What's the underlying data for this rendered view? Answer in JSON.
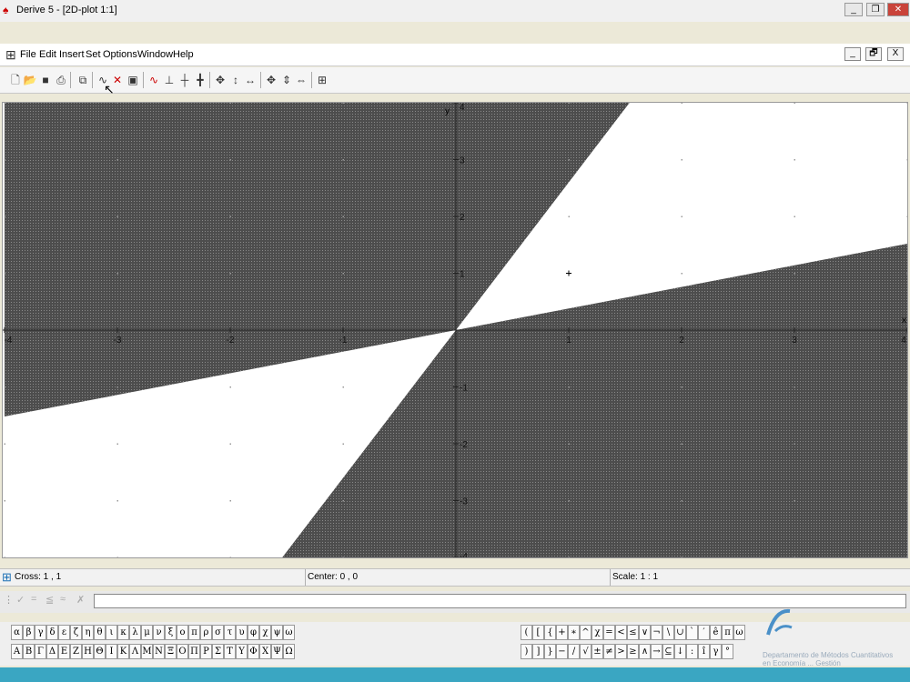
{
  "window": {
    "title": "Derive 5 - [2D-plot 1:1]",
    "buttons": [
      "_",
      "❐",
      "✕"
    ]
  },
  "menubar": {
    "items": [
      "File",
      "Edit",
      "Insert",
      "Set",
      "Options",
      "Window",
      "Help"
    ],
    "mdi_buttons": [
      "_",
      "🗗",
      "X"
    ]
  },
  "toolbar": {
    "icons": [
      "new-icon",
      "open-icon",
      "save-icon",
      "print-icon",
      "copy-icon",
      "plot-icon",
      "delete-icon",
      "clipboard-icon",
      "curve-icon",
      "axes-icon",
      "cross-icon",
      "center-icon",
      "pan-icon",
      "zoom-vertical-icon",
      "zoom-horizontal-icon",
      "zoom-in-icon",
      "zoom-in-vertical-icon",
      "zoom-in-horizontal-icon",
      "grid-icon"
    ]
  },
  "plot": {
    "x_label": "x",
    "y_label": "y",
    "x_ticks": [
      "-4",
      "-3",
      "-2",
      "-1",
      "1",
      "2",
      "3",
      "4"
    ],
    "y_ticks": [
      "4",
      "3",
      "2",
      "1",
      "-1",
      "-2",
      "-3",
      "-4"
    ],
    "xlim": [
      -4,
      4
    ],
    "ylim": [
      -4,
      4
    ],
    "cross": [
      1,
      1
    ],
    "shade_color": "#5a5a5a",
    "boundary_slopes": [
      2.6,
      0.38
    ]
  },
  "status": {
    "cross": "Cross: 1 , 1",
    "center": "Center: 0 , 0",
    "scale": "Scale: 1 : 1"
  },
  "entry": {
    "icons": [
      "✓",
      "=",
      "≦",
      "≈",
      "✗"
    ],
    "value": ""
  },
  "symbols": {
    "greek_lower": [
      "α",
      "β",
      "γ",
      "δ",
      "ε",
      "ζ",
      "η",
      "θ",
      "ι",
      "κ",
      "λ",
      "μ",
      "ν",
      "ξ",
      "ο",
      "π",
      "ρ",
      "σ",
      "τ",
      "υ",
      "φ",
      "χ",
      "ψ",
      "ω"
    ],
    "greek_upper": [
      "Α",
      "Β",
      "Γ",
      "Δ",
      "Ε",
      "Ζ",
      "Η",
      "Θ",
      "Ι",
      "Κ",
      "Λ",
      "Μ",
      "Ν",
      "Ξ",
      "Ο",
      "Π",
      "Ρ",
      "Σ",
      "Τ",
      "Υ",
      "Φ",
      "Χ",
      "Ψ",
      "Ω"
    ],
    "math_row1": [
      "(",
      "[",
      "{",
      "+",
      "∗",
      "^",
      "χ",
      "=",
      "<",
      "≤",
      "∨",
      "¬",
      "\\",
      "∪",
      "`",
      "′",
      "ê",
      "π",
      "ω"
    ],
    "math_row2": [
      ")",
      "]",
      "}",
      "−",
      "/",
      "√",
      "±",
      "≠",
      ">",
      "≥",
      "∧",
      "→",
      "⊆",
      "↓",
      ":",
      "î",
      "γ",
      "°"
    ]
  },
  "watermark": {
    "line1": "Departamento de Métodos Cuantitativos",
    "line2": "en Economía ... Gestión"
  }
}
